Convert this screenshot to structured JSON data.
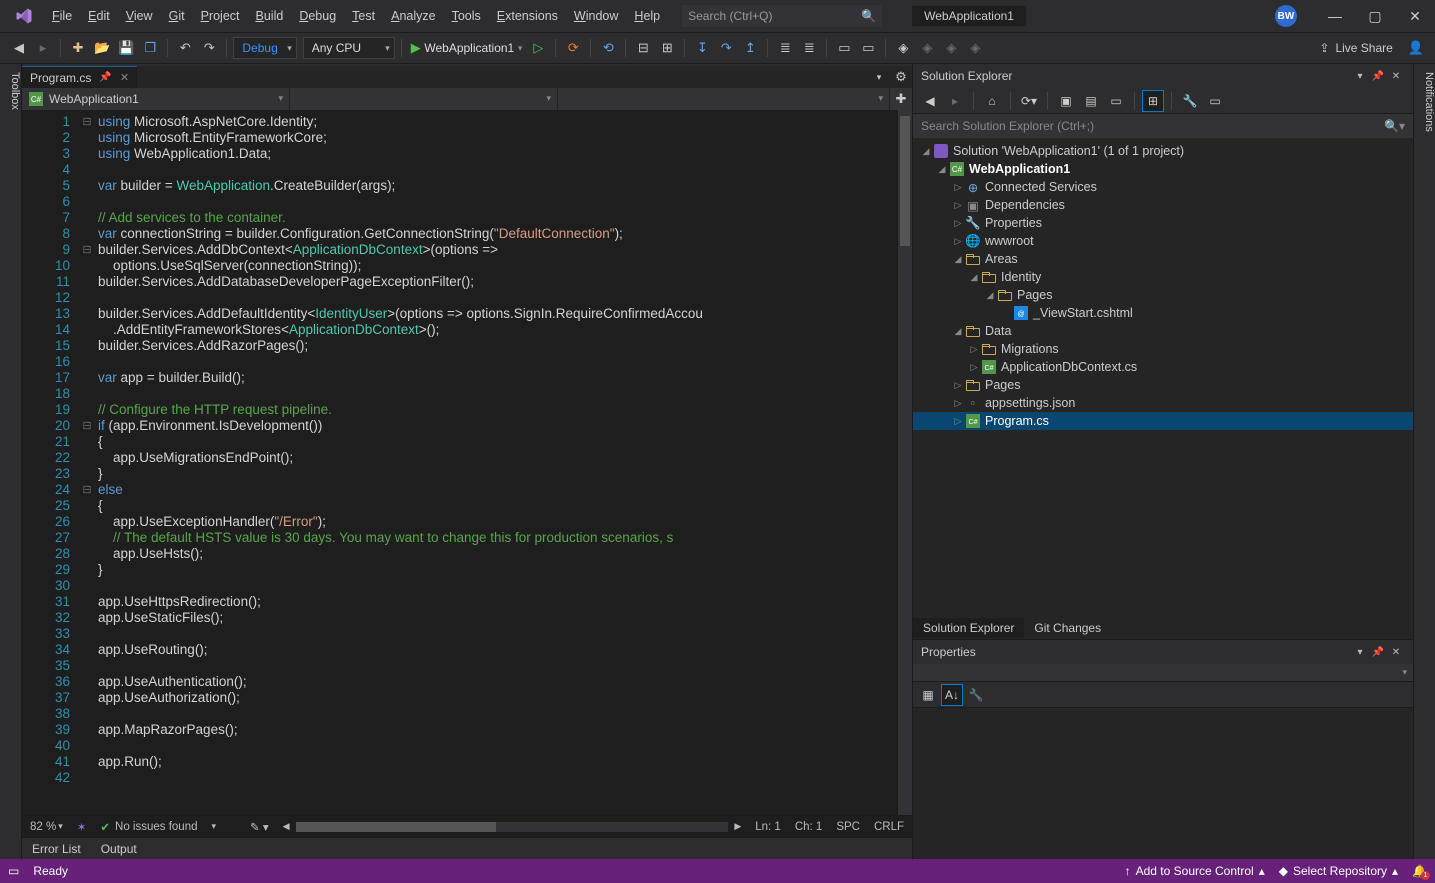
{
  "title": {
    "app": "WebApplication1"
  },
  "user": {
    "initials": "BW"
  },
  "menu": [
    "File",
    "Edit",
    "View",
    "Git",
    "Project",
    "Build",
    "Debug",
    "Test",
    "Analyze",
    "Tools",
    "Extensions",
    "Window",
    "Help"
  ],
  "search_placeholder": "Search (Ctrl+Q)",
  "toolbar": {
    "config": "Debug",
    "platform": "Any CPU",
    "run_target": "WebApplication1",
    "live_share": "Live Share"
  },
  "left_strip": "Toolbox",
  "right_strip": "Notifications",
  "tab": {
    "name": "Program.cs"
  },
  "context": {
    "project": "WebApplication1"
  },
  "editor_status": {
    "zoom": "82 %",
    "issues": "No issues found",
    "ln": "Ln: 1",
    "ch": "Ch: 1",
    "spc": "SPC",
    "crlf": "CRLF"
  },
  "bottom_tabs": [
    "Error List",
    "Output"
  ],
  "solution": {
    "header": "Solution Explorer",
    "search_placeholder": "Search Solution Explorer (Ctrl+;)",
    "root": "Solution 'WebApplication1' (1 of 1 project)",
    "project": "WebApplication1",
    "nodes": {
      "connected": "Connected Services",
      "deps": "Dependencies",
      "props": "Properties",
      "wwwroot": "wwwroot",
      "areas": "Areas",
      "identity": "Identity",
      "pages_identity": "Pages",
      "viewstart": "_ViewStart.cshtml",
      "data": "Data",
      "migrations": "Migrations",
      "appdb": "ApplicationDbContext.cs",
      "pages": "Pages",
      "appsettings": "appsettings.json",
      "program": "Program.cs"
    },
    "tabs": [
      "Solution Explorer",
      "Git Changes"
    ]
  },
  "properties": {
    "header": "Properties"
  },
  "statusbar": {
    "ready": "Ready",
    "source_control": "Add to Source Control",
    "repo": "Select Repository",
    "bell_count": "1"
  },
  "code": {
    "lines": [
      "1",
      "2",
      "3",
      "4",
      "5",
      "6",
      "7",
      "8",
      "9",
      "10",
      "11",
      "12",
      "13",
      "14",
      "15",
      "16",
      "17",
      "18",
      "19",
      "20",
      "21",
      "22",
      "23",
      "24",
      "25",
      "26",
      "27",
      "28",
      "29",
      "30",
      "31",
      "32",
      "33",
      "34",
      "35",
      "36",
      "37",
      "38",
      "39",
      "40",
      "41",
      "42"
    ]
  }
}
